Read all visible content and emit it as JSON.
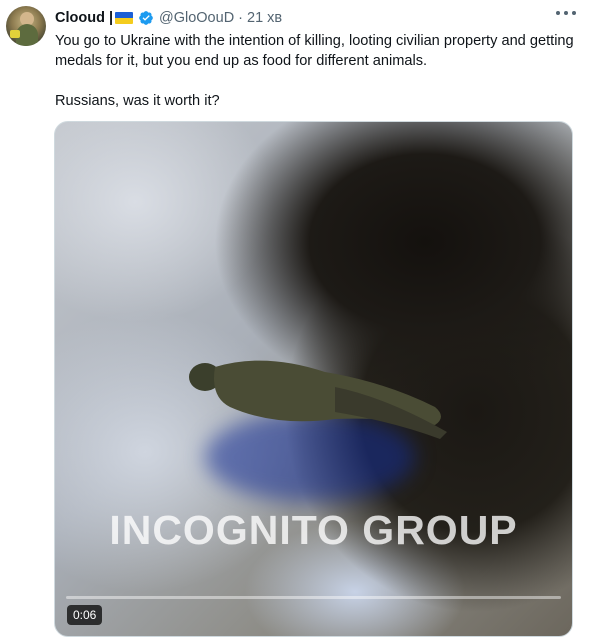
{
  "tweet": {
    "author": {
      "display_name": "Clooud",
      "flag": "ukraine-flag-icon",
      "separator": "|",
      "handle": "@GloOouD",
      "time_sep": "·",
      "time": "21 хв",
      "verified_icon": "verified-badge-icon"
    },
    "text": {
      "line1": "You go to Ukraine with the intention of killing, looting civilian property and getting medals for it, but you end up as food for different animals.",
      "line2": "Russians, was it worth it?"
    },
    "media": {
      "watermark": "INCOGNITO GROUP",
      "duration": "0:06"
    },
    "more_icon": "more-horizontal-icon"
  },
  "colors": {
    "text_primary": "#0f1419",
    "text_secondary": "#536471",
    "verified_blue": "#1d9bf0",
    "flag_blue": "#1b5fd6",
    "flag_yellow": "#f4cc1d"
  }
}
